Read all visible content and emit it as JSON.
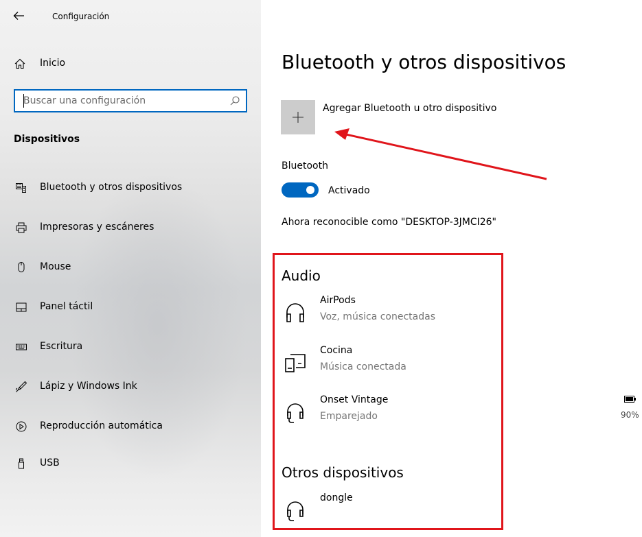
{
  "window": {
    "title": "Configuración"
  },
  "sidebar": {
    "home_label": "Inicio",
    "search": {
      "placeholder": "Buscar una configuración",
      "value": ""
    },
    "section_title": "Dispositivos",
    "items": [
      {
        "label": "Bluetooth y otros dispositivos",
        "icon": "bluetooth-devices-icon"
      },
      {
        "label": "Impresoras y escáneres",
        "icon": "printer-icon"
      },
      {
        "label": "Mouse",
        "icon": "mouse-icon"
      },
      {
        "label": "Panel táctil",
        "icon": "touchpad-icon"
      },
      {
        "label": "Escritura",
        "icon": "keyboard-icon"
      },
      {
        "label": "Lápiz y Windows Ink",
        "icon": "pen-icon"
      },
      {
        "label": "Reproducción automática",
        "icon": "autoplay-icon"
      },
      {
        "label": "USB",
        "icon": "usb-icon"
      }
    ]
  },
  "main": {
    "title": "Bluetooth y otros dispositivos",
    "add_device_label": "Agregar Bluetooth u otro dispositivo",
    "bluetooth_label": "Bluetooth",
    "bluetooth_state": "Activado",
    "bluetooth_on": true,
    "discoverable_text": "Ahora reconocible como \"DESKTOP-3JMCI26\"",
    "audio": {
      "title": "Audio",
      "devices": [
        {
          "name": "AirPods",
          "status": "Voz, música conectadas",
          "icon": "headphones-icon"
        },
        {
          "name": "Cocina",
          "status": "Música conectada",
          "icon": "speaker-device-icon"
        },
        {
          "name": "Onset Vintage",
          "status": "Emparejado",
          "icon": "headset-icon",
          "battery": "90%"
        }
      ]
    },
    "other": {
      "title": "Otros dispositivos",
      "devices": [
        {
          "name": "dongle",
          "icon": "headset-icon"
        }
      ]
    }
  },
  "colors": {
    "accent": "#0067c0",
    "annotation": "#e0151b",
    "secondary_text": "#767676",
    "add_tile": "#cccccc"
  }
}
